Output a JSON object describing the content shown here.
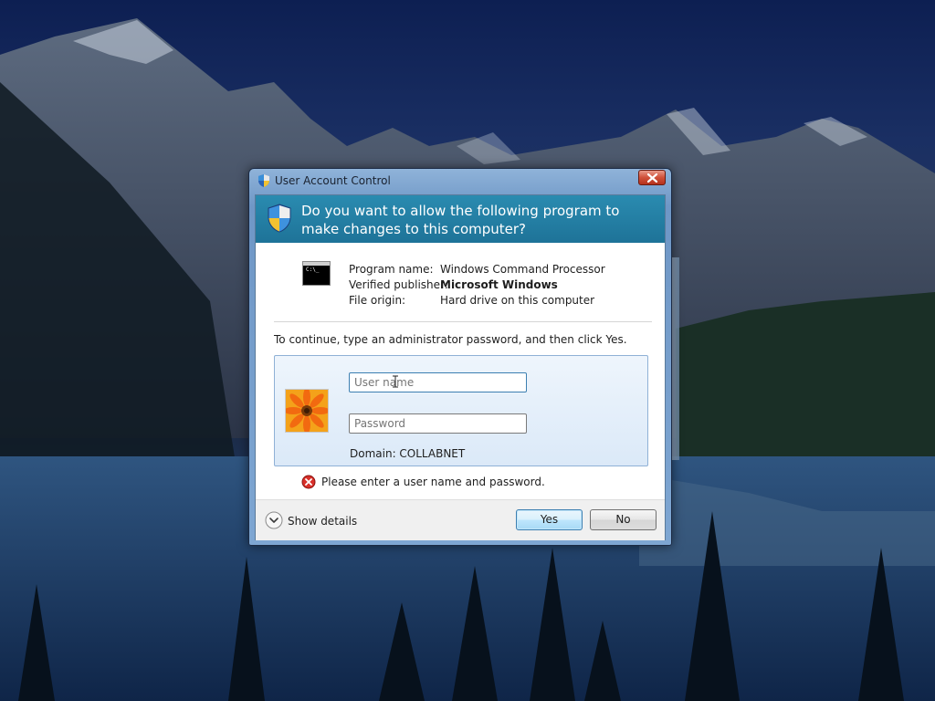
{
  "window": {
    "title": "User Account Control",
    "close_icon": "close-icon"
  },
  "header": {
    "question": "Do you want to allow the following program to make changes to this computer?",
    "icon": "uac-shield-icon"
  },
  "program": {
    "icon": "command-prompt-icon",
    "icon_text": "C:\\_",
    "name_label": "Program name:",
    "name_value": "Windows Command Processor",
    "publisher_label": "Verified publisher:",
    "publisher_value": "Microsoft Windows",
    "origin_label": "File origin:",
    "origin_value": "Hard drive on this computer"
  },
  "instruction": "To continue, type an administrator password, and then click Yes.",
  "credentials": {
    "avatar": "flower-avatar",
    "username_placeholder": "User name",
    "username_value": "",
    "password_placeholder": "Password",
    "password_value": "",
    "domain": "Domain: COLLABNET"
  },
  "error": {
    "icon": "error-icon",
    "message": "Please enter a user name and password."
  },
  "footer": {
    "show_details": "Show details",
    "yes": "Yes",
    "no": "No"
  },
  "colors": {
    "header_band": "#1e7398",
    "tile_border": "#8fb1d6",
    "yes_border": "#3c7fb1",
    "close_red": "#c0391f"
  }
}
